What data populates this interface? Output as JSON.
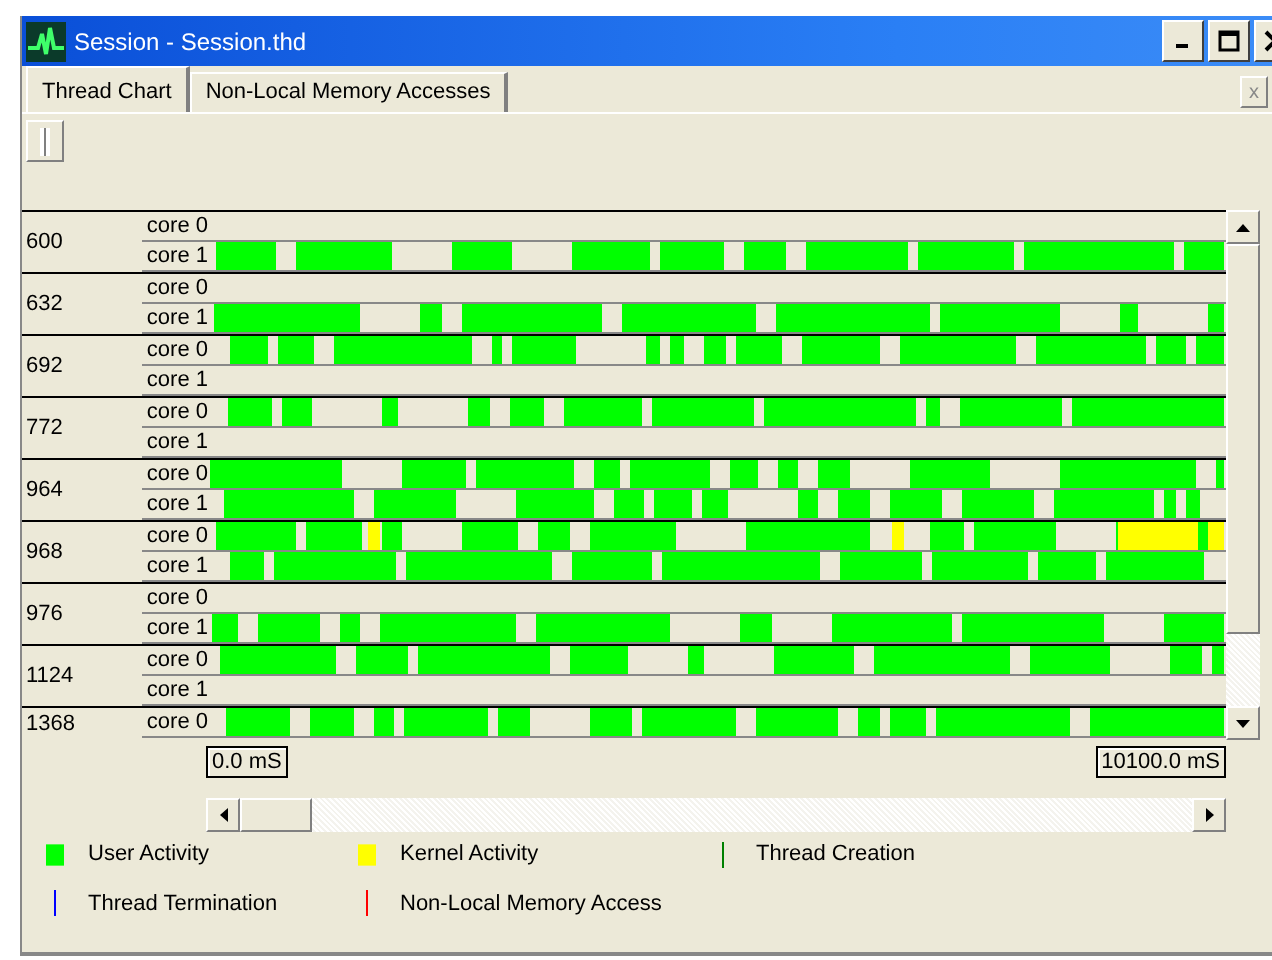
{
  "window": {
    "title": "Session - Session.thd"
  },
  "tabs": [
    {
      "label": "Thread Chart",
      "selected": true
    },
    {
      "label": "Non-Local Memory Accesses",
      "selected": false
    }
  ],
  "close_tab": "x",
  "threads": [
    {
      "id": "600",
      "cores": [
        {
          "label": "core 0",
          "active": false,
          "kernel": false
        },
        {
          "label": "core 1",
          "active": true,
          "kernel": false
        }
      ]
    },
    {
      "id": "632",
      "cores": [
        {
          "label": "core 0",
          "active": false,
          "kernel": false
        },
        {
          "label": "core 1",
          "active": true,
          "kernel": false
        }
      ]
    },
    {
      "id": "692",
      "cores": [
        {
          "label": "core 0",
          "active": true,
          "kernel": false
        },
        {
          "label": "core 1",
          "active": false,
          "kernel": false
        }
      ]
    },
    {
      "id": "772",
      "cores": [
        {
          "label": "core 0",
          "active": true,
          "kernel": false
        },
        {
          "label": "core 1",
          "active": false,
          "kernel": false
        }
      ]
    },
    {
      "id": "964",
      "cores": [
        {
          "label": "core 0",
          "active": true,
          "kernel": false
        },
        {
          "label": "core 1",
          "active": true,
          "kernel": false
        }
      ]
    },
    {
      "id": "968",
      "cores": [
        {
          "label": "core 0",
          "active": true,
          "kernel": true
        },
        {
          "label": "core 1",
          "active": true,
          "kernel": false
        }
      ]
    },
    {
      "id": "976",
      "cores": [
        {
          "label": "core 0",
          "active": false,
          "kernel": false
        },
        {
          "label": "core 1",
          "active": true,
          "kernel": false
        }
      ]
    },
    {
      "id": "1124",
      "cores": [
        {
          "label": "core 0",
          "active": true,
          "kernel": false
        },
        {
          "label": "core 1",
          "active": false,
          "kernel": false
        }
      ]
    },
    {
      "id": "1368",
      "cores": [
        {
          "label": "core 0",
          "active": true,
          "kernel": false
        }
      ]
    }
  ],
  "time_start": "0.0 mS",
  "time_end": "10100.0 mS",
  "legend": [
    {
      "label": "User Activity",
      "kind": "swatch",
      "color": "#00ff00"
    },
    {
      "label": "Kernel Activity",
      "kind": "swatch",
      "color": "#ffff00"
    },
    {
      "label": "Thread Creation",
      "kind": "line",
      "color": "#008000"
    },
    {
      "label": "Thread Termination",
      "kind": "line",
      "color": "#0000ff"
    },
    {
      "label": "Non-Local Memory Access",
      "kind": "line",
      "color": "#ff0000"
    }
  ]
}
